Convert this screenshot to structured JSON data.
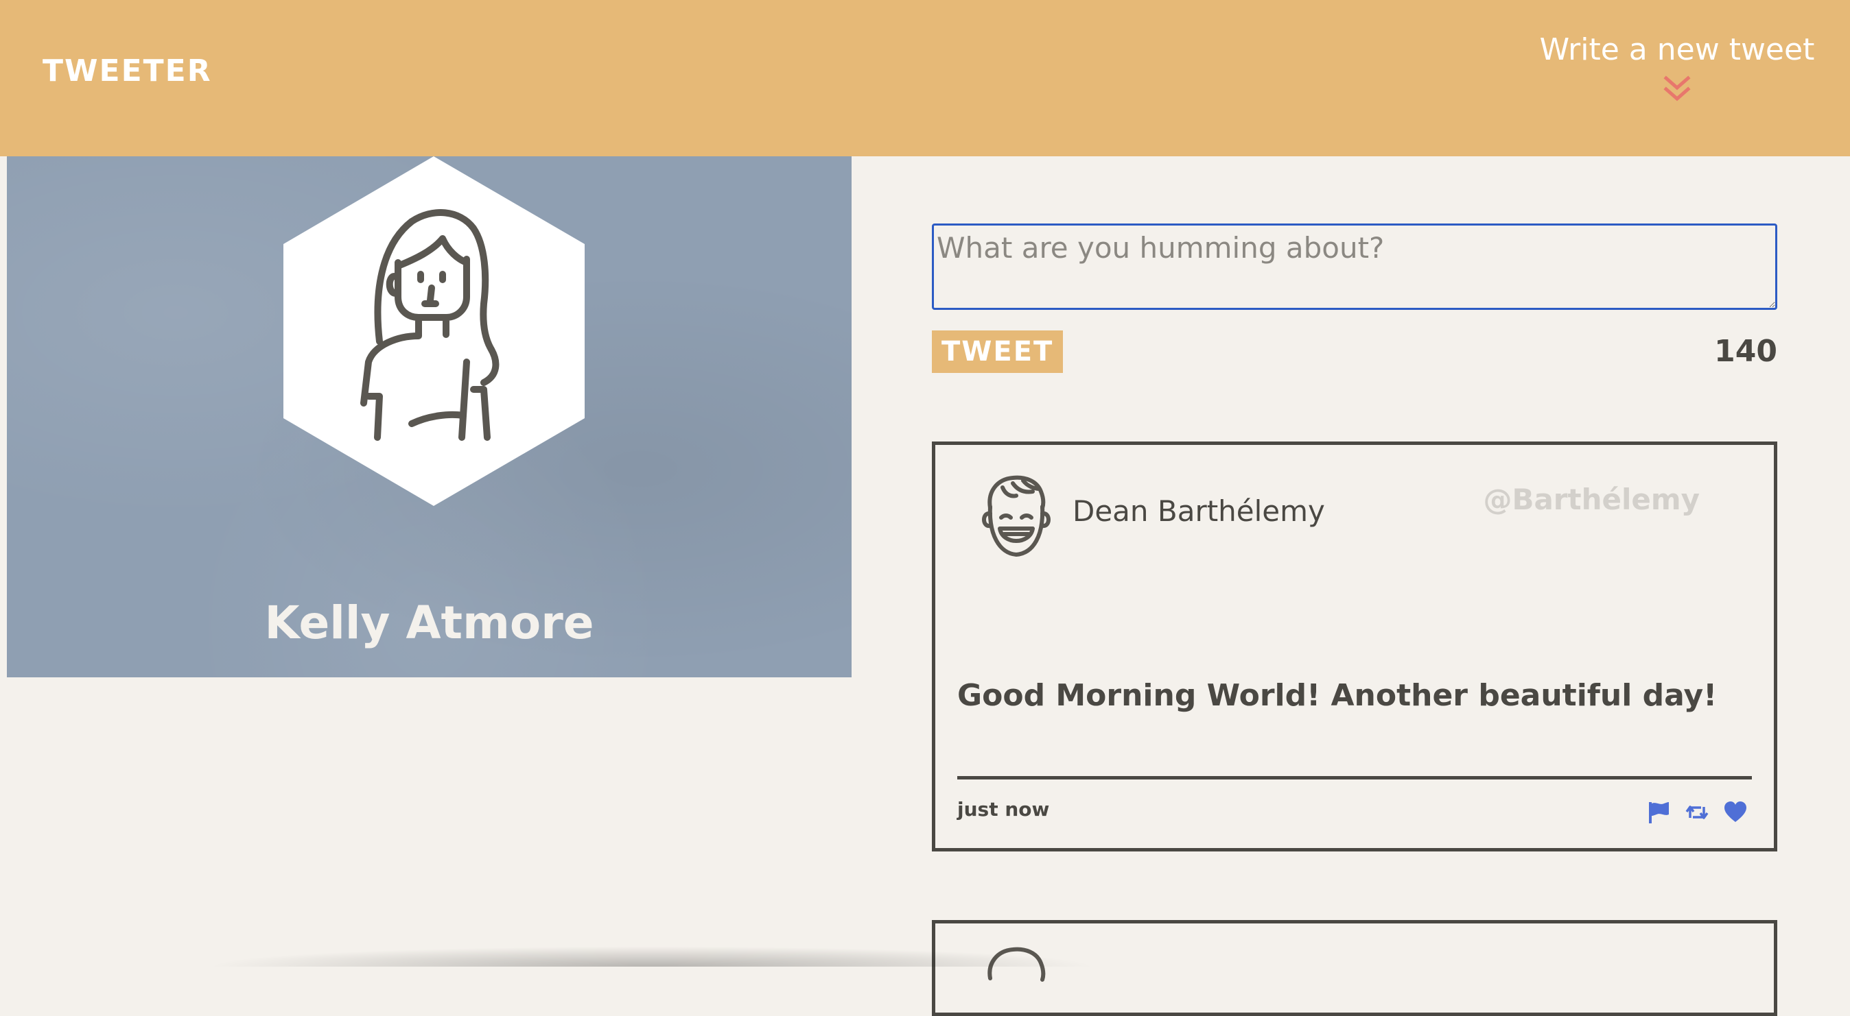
{
  "navbar": {
    "brand": "TWEETER",
    "compose_toggle_label": "Write a new tweet",
    "compose_toggle_icon": "double-chevron-down-icon"
  },
  "profile": {
    "name": "Kelly Atmore",
    "avatar_icon": "female-user-avatar-icon"
  },
  "composer": {
    "placeholder": "What are you humming about?",
    "value": "",
    "submit_label": "TWEET",
    "char_counter": "140"
  },
  "tweets": [
    {
      "author": "Dean Barthélemy",
      "handle": "@Barthélemy",
      "avatar_icon": "male-user-avatar-icon",
      "content": "Good Morning World! Another beautiful day!",
      "timestamp": "just now",
      "actions": [
        "flag-icon",
        "retweet-icon",
        "heart-icon"
      ]
    }
  ],
  "colors": {
    "header_bg": "#e6b977",
    "page_bg": "#f4f1ec",
    "profile_bg": "#8f9fb2",
    "text_dark": "#4a4843",
    "accent_red": "#e8776c",
    "action_blue": "#4f6fd6",
    "focus_blue": "#2c5bc4"
  }
}
